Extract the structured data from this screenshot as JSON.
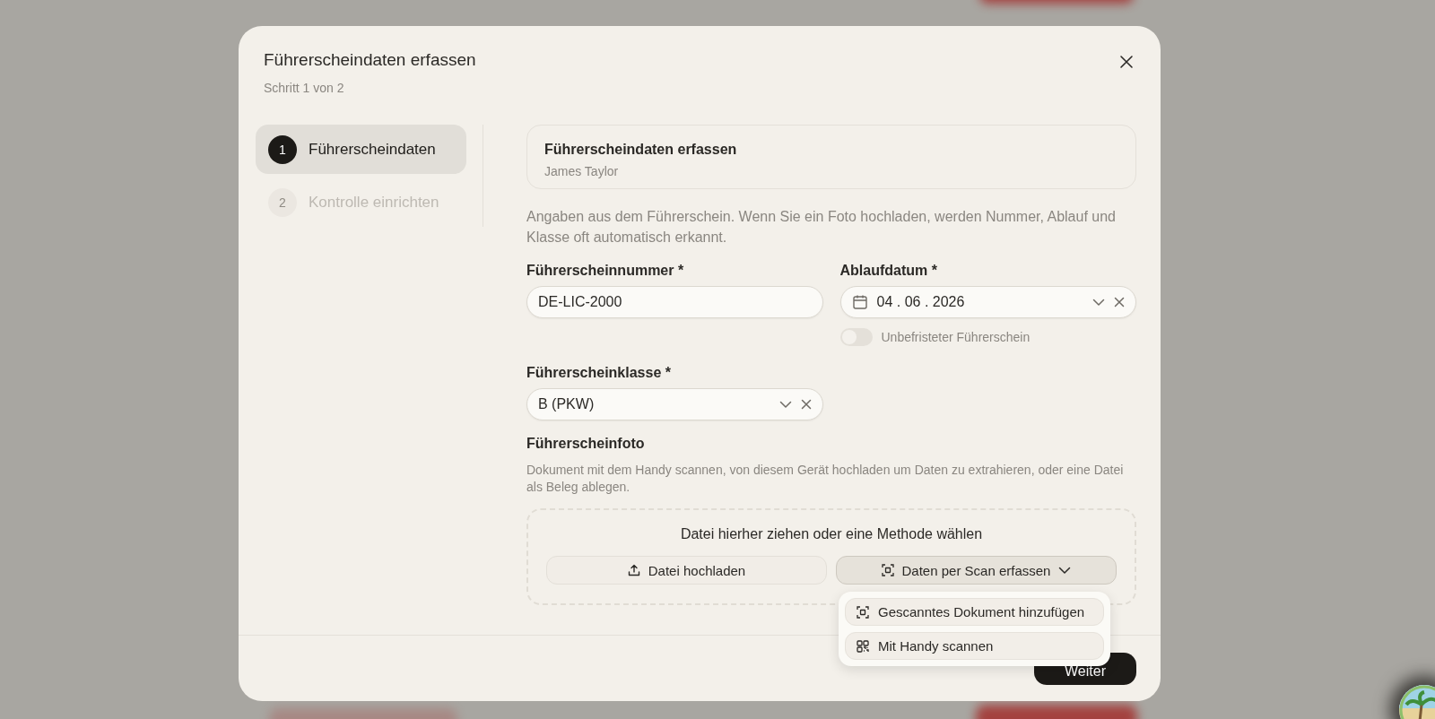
{
  "dialog": {
    "title": "Führerscheindaten erfassen",
    "subtitle": "Schritt 1 von 2"
  },
  "steps": [
    {
      "number": "1",
      "label": "Führerscheindaten",
      "selected": true
    },
    {
      "number": "2",
      "label": "Kontrolle einrichten",
      "selected": false
    }
  ],
  "summary": {
    "title": "Führerscheindaten erfassen",
    "subtitle": "James Taylor"
  },
  "intro": "Angaben aus dem Führerschein. Wenn Sie ein Foto hochladen, werden Nummer, Ablauf und Klasse oft automatisch erkannt.",
  "fields": [
    {
      "kind": "text",
      "label": "Führerscheinnummer *",
      "value": "DE-LIC-2000"
    },
    {
      "kind": "date",
      "label": "Ablaufdatum *",
      "value": "04 . 06 . 2026",
      "toggle": {
        "label": "Unbefristeter Führerschein",
        "on": false
      }
    },
    {
      "kind": "select",
      "label": "Führerscheinklasse *",
      "value": "B (PKW)"
    }
  ],
  "photo": {
    "label": "Führerscheinfoto",
    "hint": "Dokument mit dem Handy scannen, von diesem Gerät hochladen um Daten zu extrahieren, oder eine Datei als Beleg ablegen.",
    "drop_text": "Datei hierher ziehen oder eine Methode wählen",
    "buttons": [
      {
        "kind": "upload",
        "label": "Datei hochladen"
      },
      {
        "kind": "scan",
        "label": "Daten per Scan erfassen",
        "expanded": true
      }
    ],
    "menu": [
      {
        "kind": "scan",
        "label": "Gescanntes Dokument hinzufügen"
      },
      {
        "kind": "qr",
        "label": "Mit Handy scannen"
      }
    ]
  },
  "footer": {
    "next": "Weiter"
  }
}
